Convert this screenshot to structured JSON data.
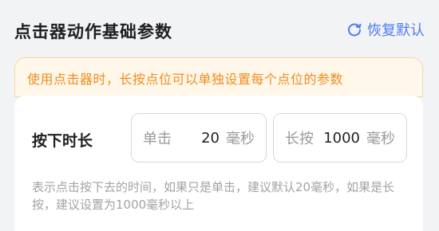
{
  "header": {
    "title": "点击器动作基础参数",
    "reset_label": "恢复默认"
  },
  "tip": {
    "text": "使用点击器时，长按点位可以单独设置每个点位的参数"
  },
  "press_duration": {
    "label": "按下时长",
    "click": {
      "label": "单击",
      "value": "20",
      "unit": "毫秒"
    },
    "long_press": {
      "label": "长按",
      "value": "1000",
      "unit": "毫秒"
    },
    "description": "表示点击按下去的时间，如果只是单击，建议默认20毫秒，如果是长按，建议设置为1000毫秒以上"
  },
  "colors": {
    "accent": "#4e7cf5",
    "tip_text": "#f08c1f",
    "tip_bg": "#fff7e9"
  },
  "icons": {
    "reset": "refresh-icon"
  }
}
